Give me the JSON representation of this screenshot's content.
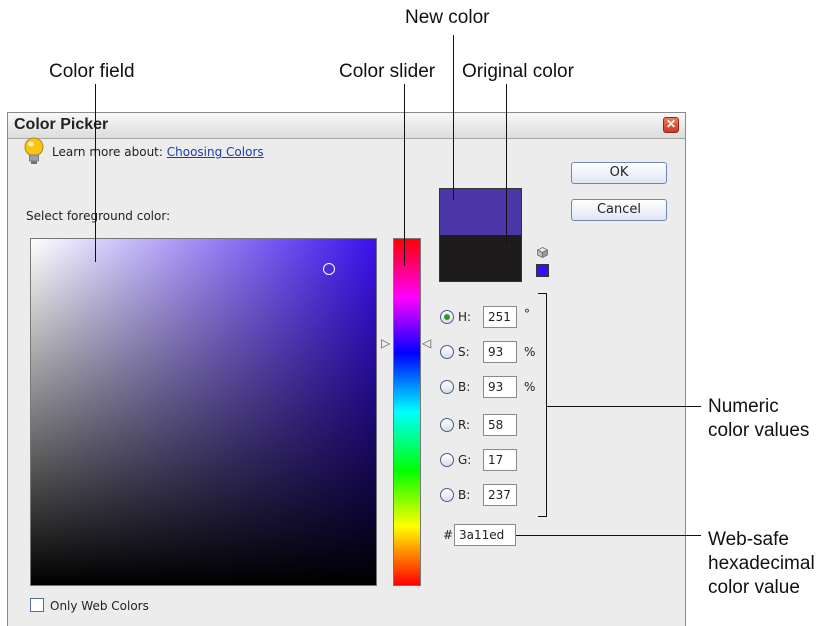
{
  "callouts": {
    "new_color": "New color",
    "color_field": "Color field",
    "color_slider": "Color slider",
    "original_color": "Original color",
    "numeric_line1": "Numeric",
    "numeric_line2": "color values",
    "web_line1": "Web-safe",
    "web_line2": "hexadecimal",
    "web_line3": "color value"
  },
  "dialog": {
    "title": "Color Picker",
    "close_glyph": "✕",
    "learn_more_prefix": "Learn more about:",
    "learn_more_link": "Choosing Colors",
    "select_label": "Select foreground color:",
    "ok_label": "OK",
    "cancel_label": "Cancel",
    "only_web_colors": "Only Web Colors"
  },
  "colors": {
    "current": "#3a11ed",
    "new_swatch": "#4b36a8",
    "original_swatch": "#1e1b1c"
  },
  "values": {
    "h_label": "H:",
    "h": "251",
    "h_unit": "°",
    "s_label": "S:",
    "s": "93",
    "s_unit": "%",
    "b_label": "B:",
    "b": "93",
    "b_unit": "%",
    "r_label": "R:",
    "r": "58",
    "g_label": "G:",
    "g": "17",
    "b2_label": "B:",
    "b2": "237",
    "hash": "#",
    "hex": "3a11ed"
  },
  "icons": {
    "lightbulb": "lightbulb-icon",
    "web_safe_cube": "cube-icon",
    "slider_left": "triangle-right-icon",
    "slider_right": "triangle-left-icon"
  }
}
